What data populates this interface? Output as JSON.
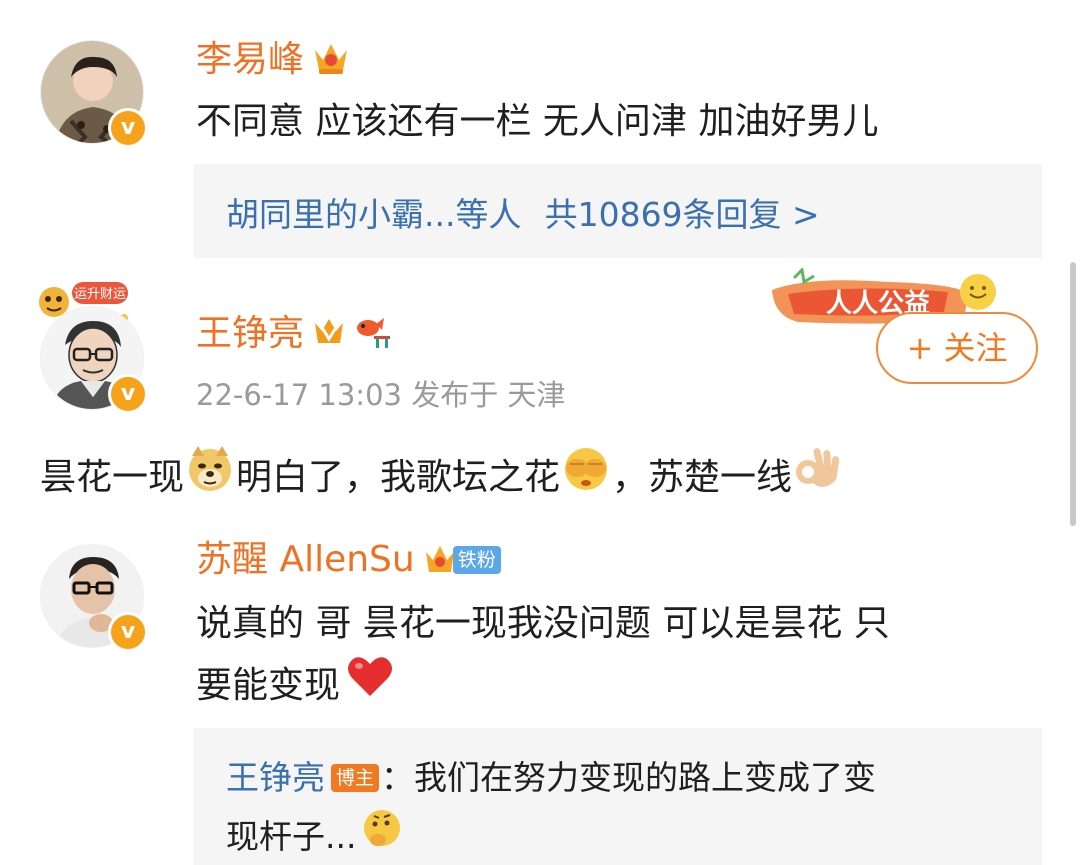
{
  "comments": [
    {
      "name": "李易峰",
      "text": "不同意 应该还有一栏 无人问津 加油好男儿",
      "replies_summary": {
        "preview": "胡同里的小霸...等人",
        "count_text": "共10869条回复 >"
      }
    },
    {
      "name": "王铮亮",
      "meta": "22-6-17 13:03  发布于 天津",
      "follow_label": "+ 关注",
      "promo_text": "人人公益",
      "avatar_tag": "运升财运",
      "text_parts": [
        "昙花一现",
        "明白了，我歌坛之花",
        "，苏楚一线"
      ]
    },
    {
      "name": "苏醒 AllenSu",
      "fan_badge": "铁粉",
      "text_line1": "说真的 哥 昙花一现我没问题 可以是昙花 只",
      "text_line2": "要能变现",
      "reply": {
        "author": "王铮亮",
        "role_badge": "博主",
        "text_line1": "：我们在努力变现的路上变成了变",
        "text_line2": "现杆子..."
      }
    }
  ],
  "icons": {
    "verified": "verified-v-icon",
    "crown": "crown-icon",
    "fan_badge": "crown-fan-badge-icon"
  },
  "colors": {
    "name": "#ef7224",
    "link": "#3a6fb0",
    "verified": "#f7a21b",
    "meta": "#9a9a9a",
    "reply_bg": "#f5f5f5",
    "follow_border": "#f08a3a"
  }
}
